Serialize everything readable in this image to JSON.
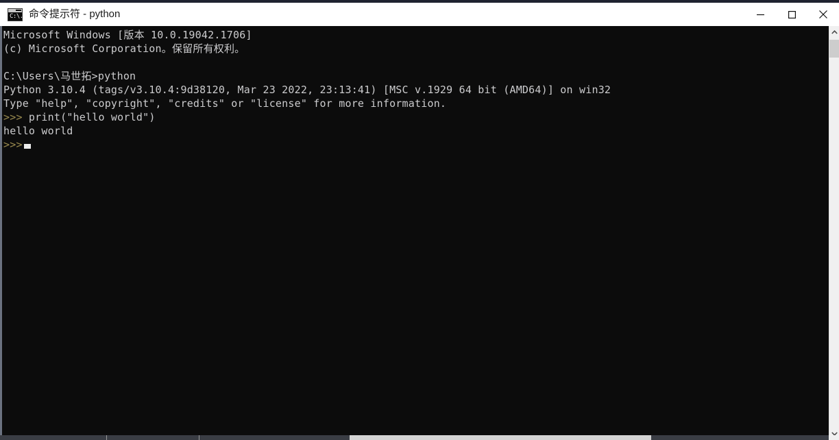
{
  "window": {
    "title": "命令提示符 - python",
    "app_icon_name": "cmd-icon",
    "app_icon_text": "C:\\.",
    "background_color": "#0c0c0c",
    "titlebar_color": "#ffffff",
    "controls": {
      "minimize_label": "最小化",
      "maximize_label": "最大化",
      "close_label": "关闭"
    }
  },
  "terminal": {
    "foreground_color": "#ccccce",
    "prompt_color": "#9a8b4f",
    "lines": [
      {
        "type": "output",
        "text": "Microsoft Windows [版本 10.0.19042.1706]"
      },
      {
        "type": "output",
        "text": "(c) Microsoft Corporation。保留所有权利。"
      },
      {
        "type": "blank",
        "text": ""
      },
      {
        "type": "output",
        "text": "C:\\Users\\马世拓>python"
      },
      {
        "type": "output",
        "text": "Python 3.10.4 (tags/v3.10.4:9d38120, Mar 23 2022, 23:13:41) [MSC v.1929 64 bit (AMD64)] on win32"
      },
      {
        "type": "output",
        "text": "Type \"help\", \"copyright\", \"credits\" or \"license\" for more information."
      },
      {
        "type": "input",
        "prompt": ">>>",
        "text": " print(\"hello world\")"
      },
      {
        "type": "output",
        "text": "hello world"
      },
      {
        "type": "cursor",
        "prompt": ">>>",
        "text": ""
      }
    ]
  },
  "scrollbars": {
    "vertical": {
      "up_arrow": "▲",
      "down_arrow": "▼",
      "thumb_color": "#cdcdcd",
      "track_color": "#f0f0f0"
    },
    "horizontal": {
      "thumb_color": "#d4d4d4",
      "track_color": "#3a3d44"
    }
  }
}
